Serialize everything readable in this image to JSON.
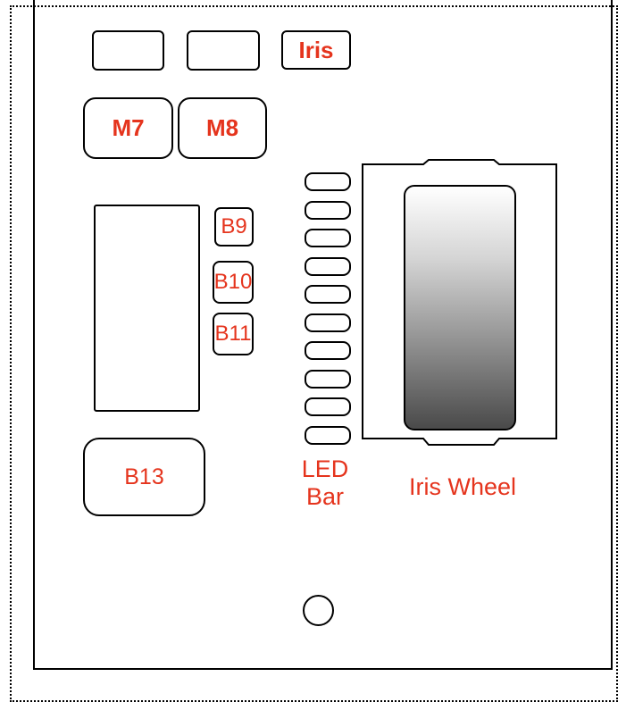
{
  "buttons": {
    "iris": "Iris",
    "m7": "M7",
    "m8": "M8",
    "b9": "B9",
    "b10": "B10",
    "b11": "B11",
    "b13": "B13"
  },
  "labels": {
    "led_bar_line1": "LED",
    "led_bar_line2": "Bar",
    "iris_wheel": "Iris Wheel"
  },
  "led_segment_count": 10,
  "colors": {
    "label": "#e5341d",
    "outline": "#000000"
  }
}
